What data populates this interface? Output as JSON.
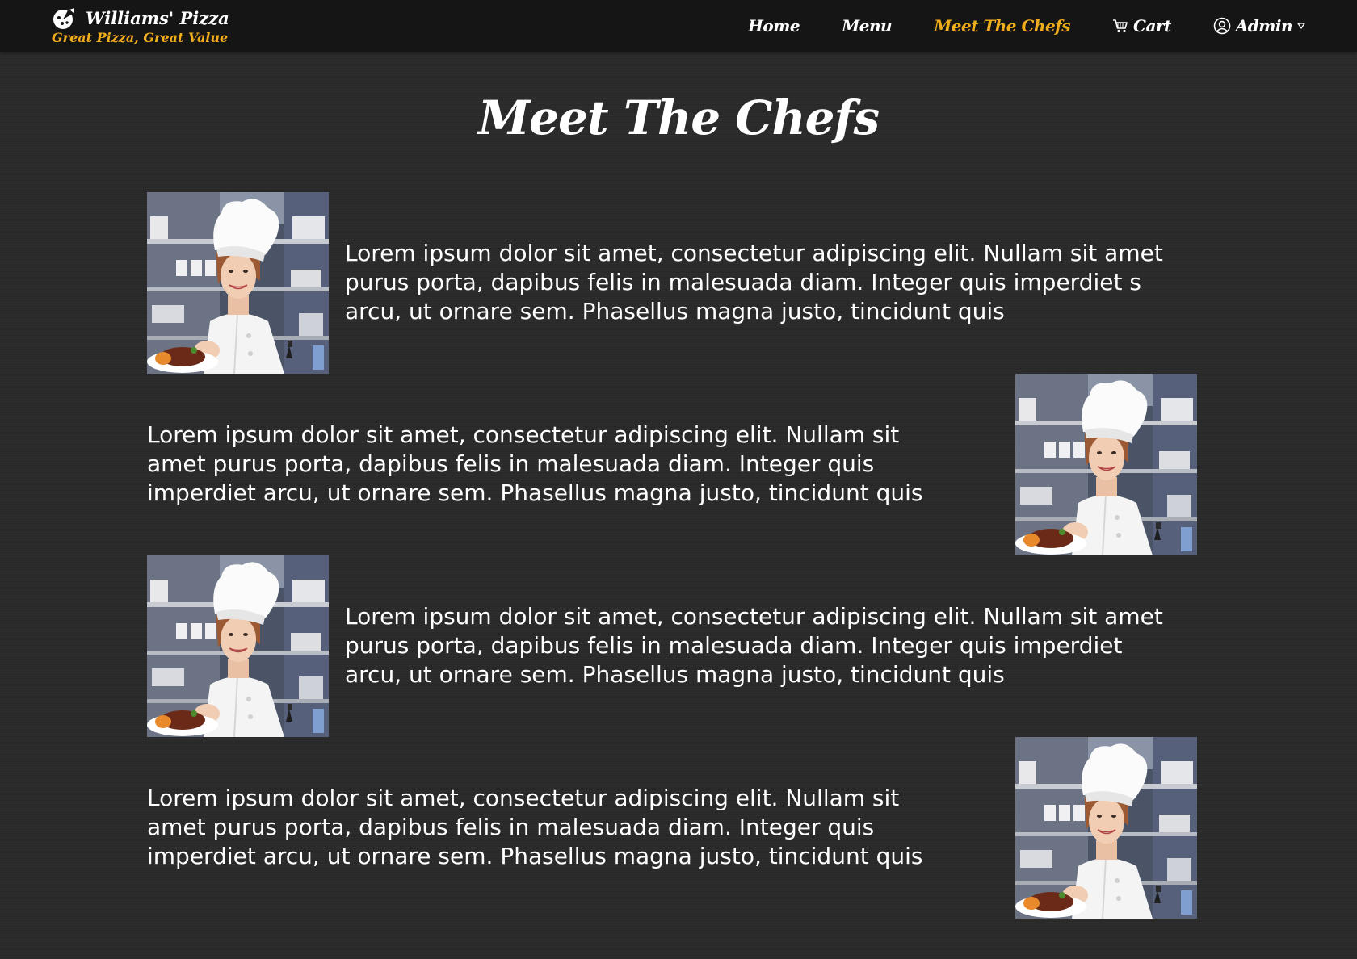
{
  "brand": {
    "name": "Williams' Pizza",
    "tagline": "Great Pizza, Great Value"
  },
  "nav": {
    "items": [
      {
        "label": "Home",
        "active": false
      },
      {
        "label": "Menu",
        "active": false
      },
      {
        "label": "Meet The Chefs",
        "active": true
      },
      {
        "label": "Cart",
        "active": false,
        "icon": "cart-icon"
      },
      {
        "label": "Admin",
        "active": false,
        "icon": "user-circle-icon",
        "dropdown": true
      }
    ]
  },
  "page": {
    "title": "Meet The Chefs"
  },
  "chefs": [
    {
      "bio": "Lorem ipsum dolor sit amet, consectetur adipiscing elit. Nullam sit amet purus porta, dapibus felis in malesuada diam. Integer quis imperdiet s arcu, ut ornare sem. Phasellus magna justo, tincidunt quis",
      "photo_side": "left"
    },
    {
      "bio": "Lorem ipsum dolor sit amet, consectetur adipiscing elit. Nullam sit amet purus porta, dapibus felis in malesuada diam. Integer quis imperdiet arcu, ut ornare sem. Phasellus magna justo, tincidunt quis",
      "photo_side": "right"
    },
    {
      "bio": "Lorem ipsum dolor sit amet, consectetur adipiscing elit. Nullam sit amet purus porta, dapibus felis in malesuada diam. Integer quis imperdiet arcu, ut ornare sem. Phasellus magna justo, tincidunt quis",
      "photo_side": "left"
    },
    {
      "bio": "Lorem ipsum dolor sit amet, consectetur adipiscing elit. Nullam sit amet purus porta, dapibus felis in malesuada diam. Integer quis imperdiet arcu, ut ornare sem. Phasellus magna justo, tincidunt quis",
      "photo_side": "right"
    }
  ],
  "colors": {
    "accent": "#f0ad1c",
    "navbar": "#151515",
    "background": "#2a2a2a"
  }
}
